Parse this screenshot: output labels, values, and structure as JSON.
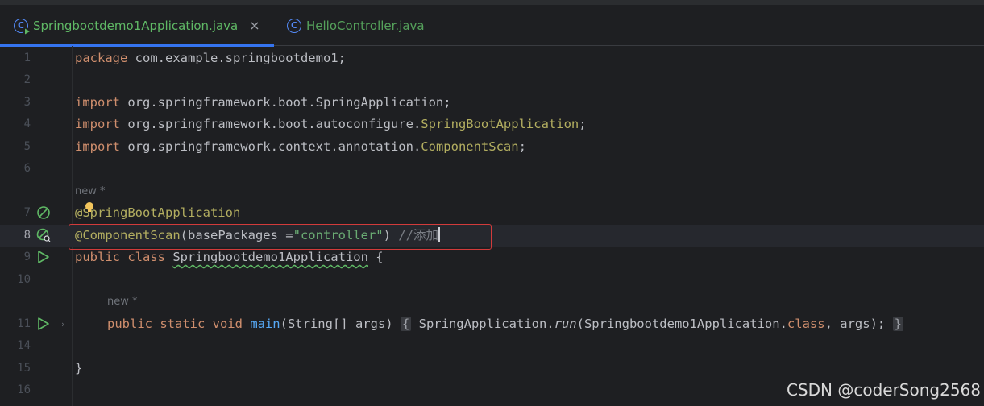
{
  "tabs": [
    {
      "label": "Springbootdemo1Application.java",
      "active": true,
      "close": "×"
    },
    {
      "label": "HelloController.java",
      "active": false
    }
  ],
  "code": {
    "l1": {
      "num": "1",
      "kw": "package",
      "rest": " com.example.springbootdemo1;"
    },
    "l2": {
      "num": "2"
    },
    "l3": {
      "num": "3",
      "kw": "import",
      "rest": " org.springframework.boot.SpringApplication;"
    },
    "l4": {
      "num": "4",
      "kw": "import",
      "rest": " org.springframework.boot.autoconfigure.",
      "ann": "SpringBootApplication",
      "end": ";"
    },
    "l5": {
      "num": "5",
      "kw": "import",
      "rest": " org.springframework.context.annotation.",
      "ann": "ComponentScan",
      "end": ";"
    },
    "l6": {
      "num": "6"
    },
    "hint_new": "new *",
    "l7": {
      "num": "7",
      "ann": "@SpringBootApplication"
    },
    "l8": {
      "num": "8",
      "ann": "@ComponentScan",
      "p1": "(basePackages =",
      "str": "\"controller\"",
      "p2": ") ",
      "cmt": "//添加"
    },
    "l9": {
      "num": "9",
      "kw": "public class ",
      "cls": "Springbootdemo1Application",
      "rest": " {"
    },
    "l10": {
      "num": "10"
    },
    "hint_new2": "new *",
    "l11": {
      "num": "11",
      "kw": "public static void ",
      "fn": "main",
      "args": "(String[] args)",
      "fold1": "{",
      "body1": " SpringApplication.",
      "run": "run",
      "body2": "(Springbootdemo1Application.",
      "cls_kw": "class",
      "body3": ", args);",
      "fold2": "}"
    },
    "l14": {
      "num": "14"
    },
    "l15": {
      "num": "15",
      "rest": "}"
    },
    "l16": {
      "num": "16"
    }
  },
  "watermark": "CSDN @coderSong2568",
  "colors": {
    "keyword": "#cf8e6d",
    "annotation": "#b3ae60",
    "string": "#6aab73",
    "comment": "#7a7e85",
    "method": "#56a8f5",
    "highlight_box": "#d23b3b"
  }
}
